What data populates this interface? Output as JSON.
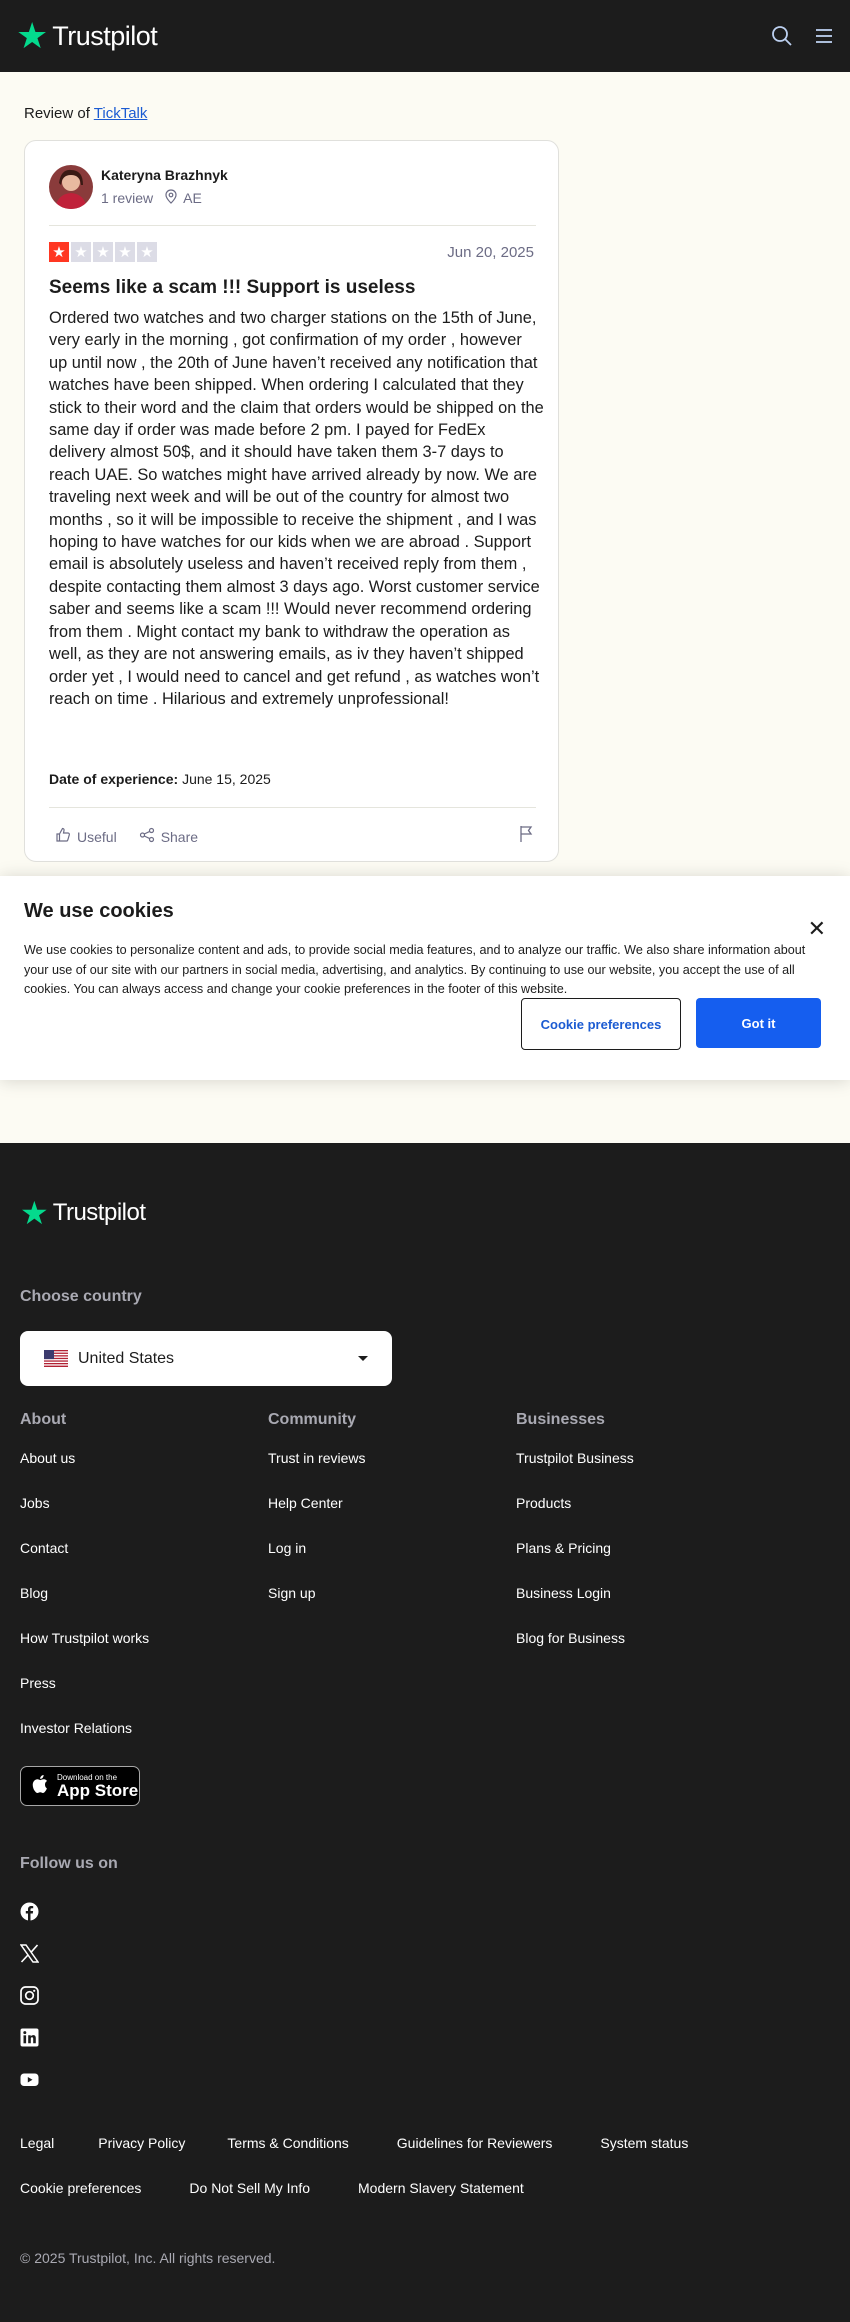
{
  "header": {
    "logo_text": "Trustpilot",
    "icons": [
      "search-icon",
      "menu-icon"
    ]
  },
  "review_of": {
    "prefix": "Review of",
    "company": "TickTalk"
  },
  "review": {
    "reviewer_name": "Kateryna Brazhnyk",
    "review_count": "1 review",
    "country": "AE",
    "rating": 1,
    "rating_max": 5,
    "date": "Jun 20, 2025",
    "title": "Seems like a scam !!! Support is useless",
    "body": "Ordered two watches and two charger stations on the 15th of June, very early in the morning , got confirmation of my order , however up until now , the 20th of June haven’t received any notification that watches have been shipped. When ordering I calculated that they stick to their word and the claim that orders would be shipped on the same day if order was made before 2 pm. I payed for FedEx delivery almost 50$, and it should have taken them 3-7 days to reach UAE. So watches might have arrived already by now. We are traveling next week and will be out of the country for almost two\nmonths , so it will be impossible to receive the shipment , and I was hoping to have watches for our kids when we are abroad . Support email is absolutely useless and haven’t received reply from them , despite contacting them almost 3 days ago. Worst customer service saber and seems like a scam !!! Would never recommend ordering from them . Might contact my bank to withdraw the operation as well, as they are not answering emails, as iv they haven’t shipped order yet , I would need to cancel and get refund , as watches won’t reach on time . Hilarious and extremely unprofessional!",
    "experience_label": "Date of experience:",
    "experience_date": "June 15, 2025",
    "useful_label": "Useful",
    "share_label": "Share"
  },
  "cookie_banner": {
    "title": "We use cookies",
    "text": "We use cookies to personalize content and ads, to provide social media features, and to analyze our traffic. We also share information about your use of our site with our partners in social media, advertising, and analytics. By continuing to use our website, you accept the use of all cookies. You can always access and change your cookie preferences in the footer of this website.",
    "preferences_label": "Cookie preferences",
    "accept_label": "Got it"
  },
  "footer": {
    "logo_text": "Trustpilot",
    "choose_country_label": "Choose country",
    "selected_country": "United States",
    "columns": [
      {
        "heading": "About",
        "links": [
          "About us",
          "Jobs",
          "Contact",
          "Blog",
          "How Trustpilot works",
          "Press",
          "Investor Relations"
        ]
      },
      {
        "heading": "Community",
        "links": [
          "Trust in reviews",
          "Help Center",
          "Log in",
          "Sign up"
        ]
      },
      {
        "heading": "Businesses",
        "links": [
          "Trustpilot Business",
          "Products",
          "Plans & Pricing",
          "Business Login",
          "Blog for Business"
        ]
      }
    ],
    "app_store": {
      "small": "Download on the",
      "big": "App Store"
    },
    "follow_label": "Follow us on",
    "social_icons": [
      "facebook-icon",
      "x-icon",
      "instagram-icon",
      "linkedin-icon",
      "youtube-icon"
    ],
    "legal_row1": [
      "Legal",
      "Privacy Policy",
      "Terms & Conditions",
      "Guidelines for Reviewers",
      "System status"
    ],
    "legal_row2": [
      "Cookie preferences",
      "Do Not Sell My Info",
      "Modern Slavery Statement"
    ],
    "copyright": "© 2025 Trustpilot, Inc. All rights reserved."
  },
  "colors": {
    "brand_green": "#04da8d",
    "star_red": "#ff3722",
    "star_empty": "#dcdce6",
    "link_blue": "#1b5bd2",
    "button_blue": "#155eef",
    "dark_bg": "#1c1c1c",
    "page_bg": "#fcfbf3"
  }
}
